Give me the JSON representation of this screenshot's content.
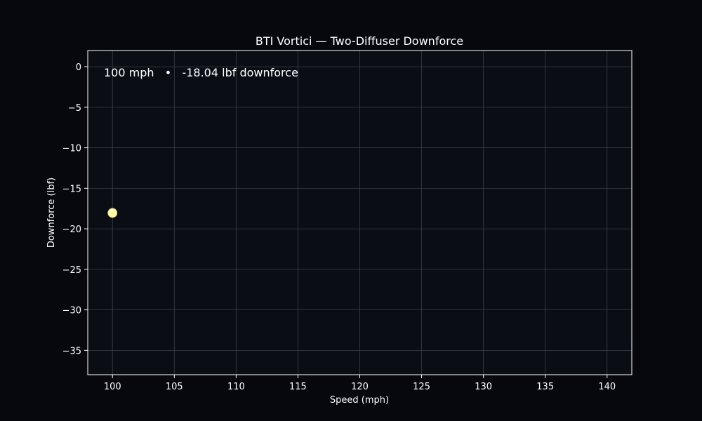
{
  "chart_data": {
    "type": "scatter",
    "title": "BTI Vortici — Two-Diffuser Downforce",
    "xlabel": "Speed (mph)",
    "ylabel": "Downforce (lbf)",
    "xlim": [
      98,
      142
    ],
    "ylim": [
      -38,
      2
    ],
    "xticks": [
      100,
      105,
      110,
      115,
      120,
      125,
      130,
      135,
      140
    ],
    "xtick_labels": [
      "100",
      "105",
      "110",
      "115",
      "120",
      "125",
      "130",
      "135",
      "140"
    ],
    "yticks": [
      0,
      -5,
      -10,
      -15,
      -20,
      -25,
      -30,
      -35
    ],
    "ytick_labels": [
      "0",
      "−5",
      "−10",
      "−15",
      "−20",
      "−25",
      "−30",
      "−35"
    ],
    "grid": true,
    "points": [
      {
        "x": 100,
        "y": -18.04
      }
    ],
    "annotation": "100 mph   •   -18.04 lbf downforce",
    "colors": {
      "figure_background": "#06080d",
      "plot_background": "#0a0e14",
      "point": "#fffba8",
      "grid": "#3a3f47",
      "text": "#ffffff"
    }
  }
}
